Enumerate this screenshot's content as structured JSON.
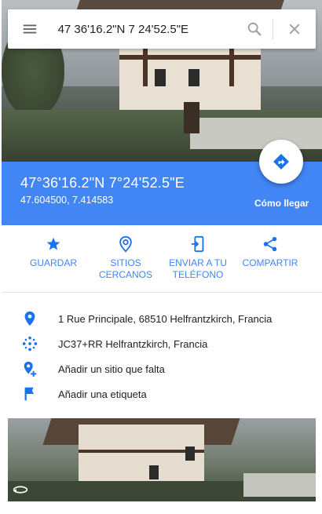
{
  "search": {
    "value": "47 36'16.2\"N 7 24'52.5\"E",
    "menu_icon": "hamburger-menu-icon",
    "search_icon": "search-icon",
    "close_icon": "close-icon"
  },
  "header": {
    "title": "47°36'16.2\"N 7°24'52.5\"E",
    "decimal": "47.604500, 7.414583",
    "directions_label": "Cómo llegar",
    "directions_icon": "directions-icon",
    "background_color": "#4285f4"
  },
  "actions": [
    {
      "label": "GUARDAR",
      "icon": "star-icon"
    },
    {
      "label": "SITIOS\nCERCANOS",
      "icon": "nearby-icon"
    },
    {
      "label": "ENVIAR A TU\nTELÉFONO",
      "icon": "send-to-phone-icon"
    },
    {
      "label": "COMPARTIR",
      "icon": "share-icon"
    }
  ],
  "info": [
    {
      "text": "1 Rue Principale, 68510 Helfrantzkirch, Francia",
      "icon": "place-pin-icon"
    },
    {
      "text": "JC37+RR Helfrantzkirch, Francia",
      "icon": "plus-code-icon"
    },
    {
      "text": "Añadir un sitio que falta",
      "icon": "add-place-icon"
    },
    {
      "text": "Añadir una etiqueta",
      "icon": "flag-icon"
    }
  ],
  "thumbnail": {
    "icon": "street-view-360-icon"
  },
  "colors": {
    "accent": "#4285f4",
    "icon_blue": "#1a73e8"
  }
}
